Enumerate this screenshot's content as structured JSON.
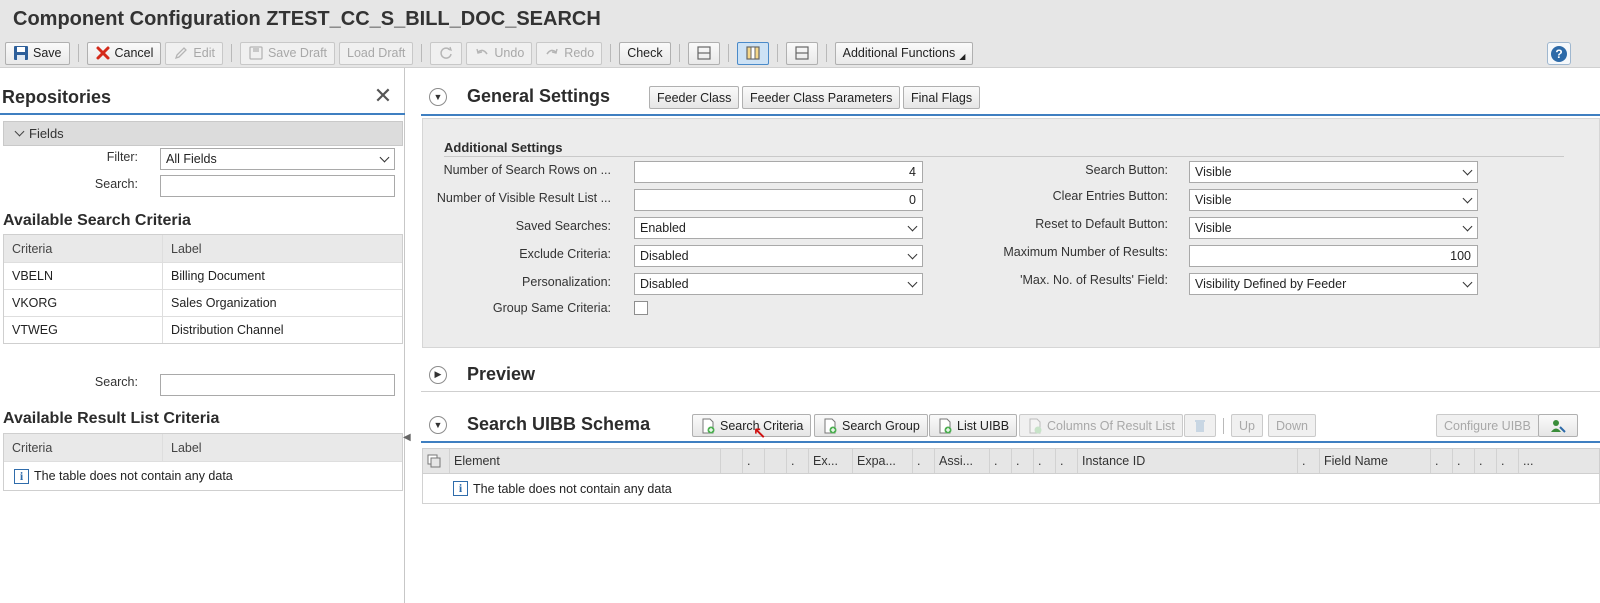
{
  "header": {
    "title": "Component Configuration ZTEST_CC_S_BILL_DOC_SEARCH"
  },
  "toolbar": {
    "save": "Save",
    "cancel": "Cancel",
    "edit": "Edit",
    "save_draft": "Save Draft",
    "load_draft": "Load Draft",
    "undo": "Undo",
    "redo": "Redo",
    "check": "Check",
    "additional_functions": "Additional Functions",
    "help": "?"
  },
  "repositories": {
    "title": "Repositories",
    "fields_label": "Fields",
    "filter_label": "Filter:",
    "filter_value": "All Fields",
    "search_label": "Search:",
    "search_value": "",
    "available_search_criteria": {
      "title": "Available Search Criteria",
      "columns": [
        "Criteria",
        "Label"
      ],
      "rows": [
        {
          "criteria": "VBELN",
          "label": "Billing Document"
        },
        {
          "criteria": "VKORG",
          "label": "Sales Organization"
        },
        {
          "criteria": "VTWEG",
          "label": "Distribution Channel"
        }
      ]
    },
    "search2_label": "Search:",
    "available_result_list_criteria": {
      "title": "Available Result List Criteria",
      "columns": [
        "Criteria",
        "Label"
      ],
      "empty_text": "The table does not contain any data"
    }
  },
  "general_settings": {
    "title": "General Settings",
    "buttons": [
      "Feeder Class",
      "Feeder Class Parameters",
      "Final Flags"
    ],
    "additional_settings_title": "Additional Settings",
    "left_fields": [
      {
        "label": "Number of Search Rows on ...",
        "value": "4",
        "kind": "text"
      },
      {
        "label": "Number of Visible Result List ...",
        "value": "0",
        "kind": "text"
      },
      {
        "label": "Saved Searches:",
        "value": "Enabled",
        "kind": "dropdown"
      },
      {
        "label": "Exclude Criteria:",
        "value": "Disabled",
        "kind": "dropdown"
      },
      {
        "label": "Personalization:",
        "value": "Disabled",
        "kind": "dropdown"
      },
      {
        "label": "Group Same Criteria:",
        "value": "",
        "kind": "checkbox"
      }
    ],
    "right_fields": [
      {
        "label": "Search Button:",
        "value": "Visible",
        "kind": "dropdown"
      },
      {
        "label": "Clear Entries Button:",
        "value": "Visible",
        "kind": "dropdown"
      },
      {
        "label": "Reset to Default Button:",
        "value": "Visible",
        "kind": "dropdown"
      },
      {
        "label": "Maximum Number of Results:",
        "value": "100",
        "kind": "text"
      },
      {
        "label": "'Max. No. of Results' Field:",
        "value": "Visibility Defined by Feeder",
        "kind": "dropdown"
      }
    ]
  },
  "preview": {
    "title": "Preview"
  },
  "schema": {
    "title": "Search UIBB Schema",
    "buttons": {
      "search_criteria": "Search Criteria",
      "search_group": "Search Group",
      "list_uibb": "List UIBB",
      "columns_of_result_list": "Columns Of Result List",
      "up": "Up",
      "down": "Down",
      "configure_uibb": "Configure UIBB"
    },
    "columns": [
      "Element",
      ".",
      ".",
      "Ex...",
      "Expa...",
      ".",
      "Assi...",
      ".",
      ".",
      ".",
      ".",
      "Instance ID",
      ".",
      "Field Name",
      ".",
      ".",
      ".",
      ".",
      "..."
    ],
    "empty_text": "The table does not contain any data"
  }
}
